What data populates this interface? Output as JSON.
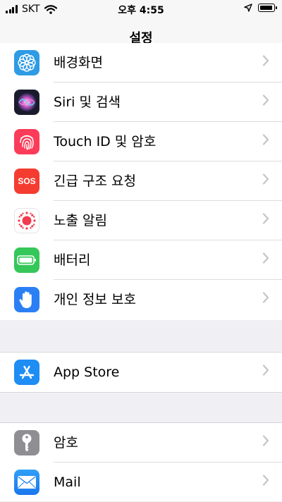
{
  "status_bar": {
    "carrier": "SKT",
    "time": "오후 4:55"
  },
  "nav": {
    "title": "설정"
  },
  "settings": {
    "wallpaper": "배경화면",
    "siri": "Siri 및 검색",
    "touch_id": "Touch ID 및 암호",
    "sos_label": "긴급 구조 요청",
    "sos_icon_text": "SOS",
    "exposure": "노출 알림",
    "battery": "배터리",
    "privacy": "개인 정보 보호",
    "app_store": "App Store",
    "passwords": "암호",
    "mail": "Mail"
  },
  "colors": {
    "background": "#efeff4",
    "chevron": "#c4c4c9",
    "wallpaper_icon": "#2e9be4",
    "touch_id_icon": "#fb3c59",
    "sos_icon": "#f43d30",
    "battery_icon": "#35c759",
    "privacy_icon": "#2b7ff4",
    "app_store_icon": "#1e8df4",
    "passwords_icon": "#8e8e93",
    "mail_icon": "#2a8bf2"
  },
  "icons": [
    "flower-icon",
    "siri-icon",
    "fingerprint-icon",
    "sos-icon",
    "exposure-notification-icon",
    "battery-icon",
    "raised-hand-icon",
    "app-store-icon",
    "key-icon",
    "envelope-icon",
    "chevron-right-icon"
  ]
}
